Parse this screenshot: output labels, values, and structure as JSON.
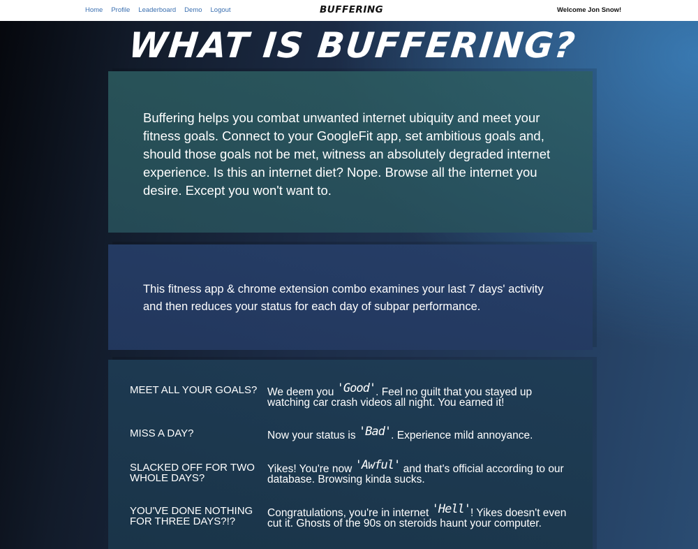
{
  "nav": {
    "links": [
      "Home",
      "Profile",
      "Leaderboard",
      "Demo",
      "Logout"
    ],
    "brand": "BUFFERING",
    "welcome": "Welcome Jon Snow!"
  },
  "hero": {
    "title": "WHAT IS BUFFERING?"
  },
  "intro": {
    "text": "Buffering helps you combat unwanted internet ubiquity and meet your fitness goals. Connect to your GoogleFit app, set ambitious goals and, should those goals not be met, witness an absolutely degraded internet experience. Is this an internet diet? Nope. Browse all the internet you desire. Except you won't want to."
  },
  "summary": {
    "text": "This fitness app & chrome extension combo examines your last 7 days' activity and then reduces your status for each day of subpar performance."
  },
  "faq": [
    {
      "question": "MEET ALL YOUR GOALS?",
      "before": "We deem you ",
      "status": "'Good'",
      "after": ". Feel no guilt that you stayed up watching car crash videos all night. You earned it!"
    },
    {
      "question": "MISS A DAY?",
      "before": "Now your status is ",
      "status": "'Bad'",
      "after": ". Experience mild annoyance."
    },
    {
      "question": "SLACKED OFF FOR TWO WHOLE DAYS?",
      "before": "Yikes! You're now ",
      "status": "'Awful'",
      "after": " and that's official according to our database. Browsing kinda sucks."
    },
    {
      "question": "YOU'VE DONE NOTHING FOR THREE DAYS?!?",
      "before": "Congratulations, you're in internet ",
      "status": "'Hell'",
      "after": "! Yikes doesn't even cut it. Ghosts of the 90s on steroids haunt your computer."
    }
  ],
  "colors": {
    "nav_link": "#3a6fb0",
    "nav_bg": "#ffffff"
  }
}
